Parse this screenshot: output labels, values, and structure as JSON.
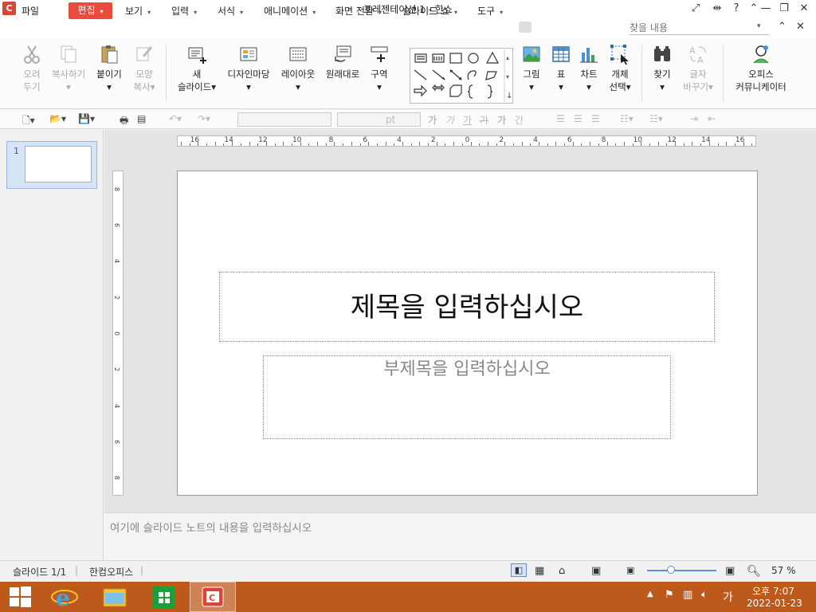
{
  "window": {
    "title": "프레젠테이션 1 - 한쇼",
    "app_icon_glyph": "C"
  },
  "menus": {
    "file": "파일",
    "edit": "편집",
    "view": "보기",
    "insert": "입력",
    "format": "서식",
    "animation": "애니메이션",
    "transition": "화면 전환",
    "slideshow": "슬라이드 쇼",
    "tools": "도구"
  },
  "search": {
    "placeholder": "찾을 내용"
  },
  "ribbon": {
    "cut": [
      "오려",
      "두기"
    ],
    "copy": "복사하기",
    "paste": "붙이기",
    "format_painter": [
      "모양",
      "복사"
    ],
    "new_slide": [
      "새",
      "슬라이드"
    ],
    "design": "디자인마당",
    "layout": "레이아웃",
    "reset": "원래대로",
    "section": "구역",
    "picture": "그림",
    "table": "표",
    "chart": "차트",
    "select_object": [
      "개체",
      "선택"
    ],
    "find": "찾기",
    "replace": [
      "글자",
      "바꾸기"
    ],
    "office_communicator": [
      "오피스",
      "커뮤니케이터"
    ]
  },
  "toolbar2": {
    "font_unit": "pt",
    "font_glyphs": [
      "가",
      "가",
      "가",
      "가",
      "가",
      "간"
    ]
  },
  "ruler": {
    "h_labels": [
      "16",
      "14",
      "12",
      "10",
      "8",
      "6",
      "4",
      "2",
      "0",
      "2",
      "4",
      "6",
      "8",
      "10",
      "12",
      "14",
      "16"
    ],
    "v_labels": [
      "8",
      "6",
      "4",
      "2",
      "0",
      "2",
      "4",
      "6",
      "8"
    ]
  },
  "thumbs": [
    {
      "number": "1"
    }
  ],
  "slide": {
    "title_placeholder": "제목을 입력하십시오",
    "subtitle_placeholder": "부제목을 입력하십시오"
  },
  "notes": {
    "placeholder": "여기에 슬라이드 노트의 내용을 입력하십시오"
  },
  "status": {
    "slide_pos": "슬라이드 1/1",
    "app_name": "한컴오피스",
    "zoom": "57 %",
    "zoom_fraction": 0.35
  },
  "taskbar": {
    "time": "오후 7:07",
    "date": "2022-01-23",
    "ime": "가"
  },
  "colors": {
    "accent": "#e74c3c",
    "taskbar": "#bd5a1b",
    "selection": "#d6e4f7"
  }
}
